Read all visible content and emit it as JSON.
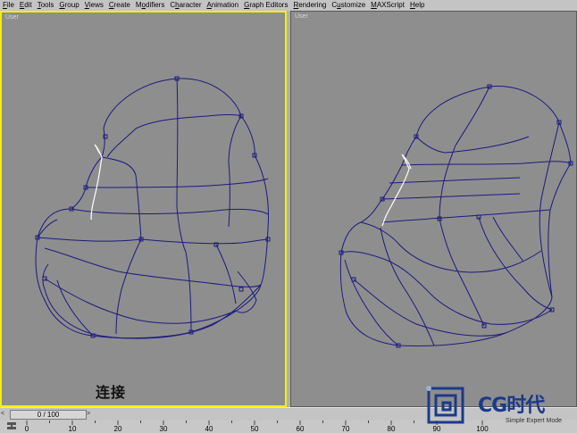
{
  "menu": [
    "File",
    "Edit",
    "Tools",
    "Group",
    "Views",
    "Create",
    "Modifiers",
    "Character",
    "Animation",
    "Graph Editors",
    "Rendering",
    "Customize",
    "MAXScript",
    "Help"
  ],
  "menu_underline": [
    "F",
    "E",
    "T",
    "G",
    "V",
    "C",
    "o",
    "h",
    "A",
    "G",
    "R",
    "u",
    "M",
    "H"
  ],
  "viewports": {
    "left": {
      "label": "User"
    },
    "right": {
      "label": "User"
    }
  },
  "caption": "连接",
  "timeline": {
    "slider_text": "0 / 100",
    "prev_glyph": "<",
    "next_glyph": ">"
  },
  "ruler": {
    "ticks": [
      "0",
      "10",
      "20",
      "30",
      "40",
      "50",
      "60",
      "70",
      "80",
      "90",
      "100"
    ]
  },
  "logo": {
    "text": "CG时代"
  },
  "status": {
    "text": "Simple Expert Mode"
  },
  "colors": {
    "wire": "#1c1a80",
    "selected": "#ffffff",
    "active_border": "#f2f200",
    "viewport_bg": "#8e8e8e"
  }
}
